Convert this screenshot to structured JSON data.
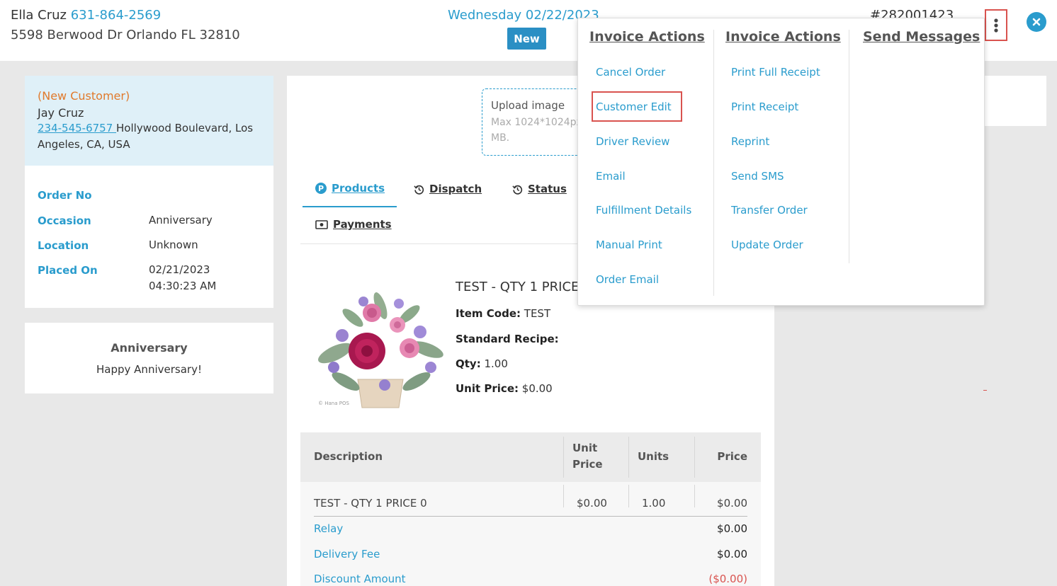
{
  "header": {
    "customer_name": "Ella Cruz",
    "customer_phone": "631-864-2569",
    "customer_address": "5598 Berwood Dr Orlando FL 32810",
    "delivery_date": "Wednesday 02/22/2023",
    "status_badge": "New",
    "order_number": "#282001423"
  },
  "customer_card": {
    "tag": "(New Customer)",
    "name": "Jay Cruz",
    "phone": "234-545-6757 ",
    "address": "Hollywood Boulevard, Los Angeles, CA, USA",
    "fields": [
      {
        "label": "Order No",
        "value": ""
      },
      {
        "label": "Occasion",
        "value": "Anniversary"
      },
      {
        "label": "Location",
        "value": "Unknown"
      },
      {
        "label": "Placed On",
        "value": "02/21/2023 04:30:23 AM"
      }
    ]
  },
  "message_card": {
    "title": "Anniversary",
    "text": "Happy Anniversary!"
  },
  "upload": {
    "label": "Upload image",
    "hint": "Max 1024*1024px, 2 MB."
  },
  "tabs": [
    {
      "label": "Products",
      "icon": "p-circle-icon",
      "active": true
    },
    {
      "label": "Dispatch",
      "icon": "history-icon",
      "active": false
    },
    {
      "label": "Status",
      "icon": "history-icon",
      "active": false
    },
    {
      "label": "Payments",
      "icon": "money-icon",
      "active": false
    }
  ],
  "product": {
    "title": "TEST - QTY 1 PRICE 0",
    "item_code_label": "Item Code:",
    "item_code": "TEST",
    "recipe_label": "Standard Recipe:",
    "qty_label": "Qty:",
    "qty": "1.00",
    "unit_price_label": "Unit Price:",
    "unit_price": "$0.00",
    "watermark": "© Hana POS"
  },
  "table": {
    "headers": {
      "description": "Description",
      "unit_price_1": "Unit",
      "unit_price_2": "Price",
      "units": "Units",
      "price": "Price"
    },
    "row": {
      "description": "TEST - QTY 1 PRICE 0",
      "unit_price": "$0.00",
      "units": "1.00",
      "price": "$0.00"
    },
    "summary": [
      {
        "label": "Relay",
        "value": "$0.00"
      },
      {
        "label": "Delivery Fee",
        "value": "$0.00"
      },
      {
        "label": "Discount Amount",
        "value": "($0.00)"
      }
    ]
  },
  "menu": {
    "col1_title": "Invoice Actions",
    "col2_title": "Invoice Actions",
    "col3_title": "Send Messages",
    "col1_items": [
      "Cancel Order",
      "Customer Edit",
      "Driver Review",
      "Email",
      "Fulfillment Details",
      "Manual Print",
      "Order Email"
    ],
    "col2_items": [
      "Print Full Receipt",
      "Print Receipt",
      "Reprint",
      "Send SMS",
      "Transfer Order",
      "Update Order"
    ]
  },
  "colors": {
    "accent": "#2a9ccd",
    "highlight": "#d9534f",
    "orange": "#e07a2c"
  }
}
